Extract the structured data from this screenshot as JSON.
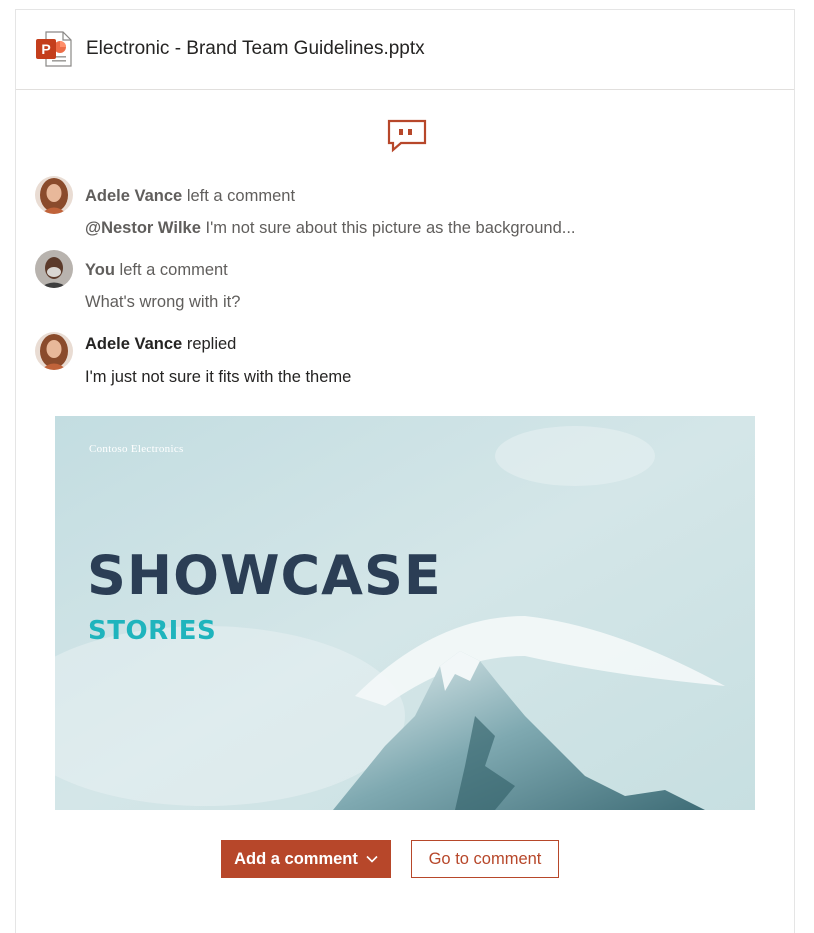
{
  "header": {
    "file_name": "Electronic - Brand Team Guidelines.pptx",
    "file_icon": "powerpoint-icon",
    "icon_letter": "P"
  },
  "colors": {
    "accent": "#b7472a",
    "slide_title": "#2b3e55",
    "slide_subtitle": "#1fb4bd",
    "muted_text": "#605e5c",
    "text": "#252423"
  },
  "comments": [
    {
      "author": "Adele Vance",
      "action": "left a comment",
      "mention": "@Nestor Wilke",
      "text": "I'm not sure about this picture as the background..."
    },
    {
      "author": "You",
      "action": "left a comment",
      "text": "What's wrong with it?"
    },
    {
      "author": "Adele Vance",
      "action": "replied",
      "text": "I'm just not sure it fits with the theme"
    }
  ],
  "slide": {
    "brand": "Contoso Electronics",
    "title": "SHOWCASE",
    "subtitle": "STORIES"
  },
  "actions": {
    "add_comment": "Add a comment",
    "go_to_comment": "Go to comment"
  }
}
